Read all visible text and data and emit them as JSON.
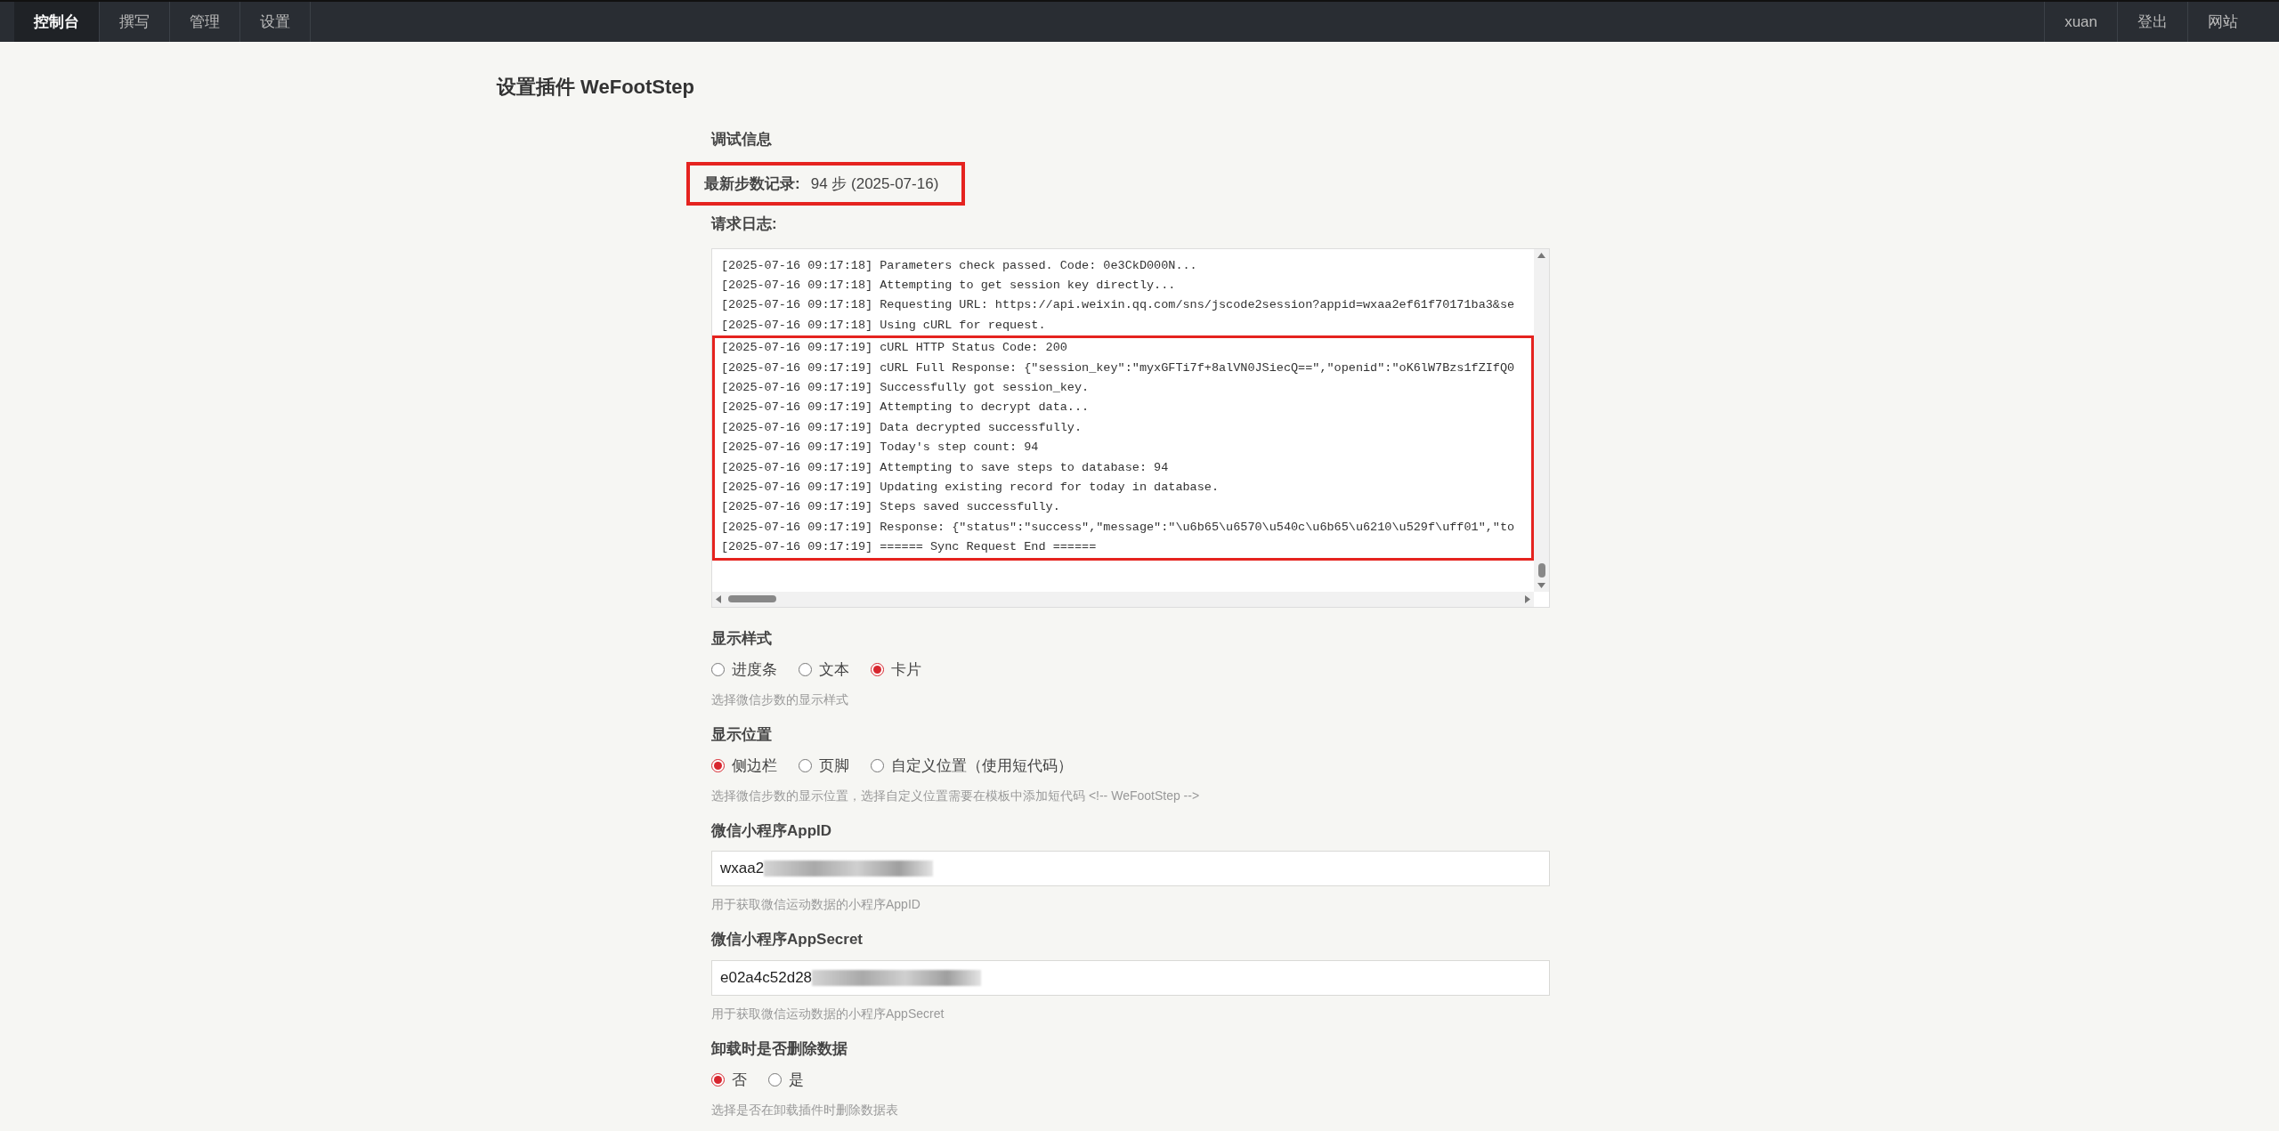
{
  "nav": {
    "items": [
      {
        "label": "控制台",
        "selected": true
      },
      {
        "label": "撰写",
        "selected": false
      },
      {
        "label": "管理",
        "selected": false
      },
      {
        "label": "设置",
        "selected": false
      }
    ],
    "right_items": [
      "xuan",
      "登出",
      "网站"
    ]
  },
  "page_title": "设置插件 WeFootStep",
  "debug": {
    "heading": "调试信息",
    "latest_label": "最新步数记录:",
    "latest_value": "94 步 (2025-07-16)",
    "latest_highlighted": true,
    "log_label": "请求日志:",
    "log_blocks": [
      {
        "highlighted": false,
        "lines": [
          "[2025-07-16 09:17:18] Parameters check passed. Code: 0e3CkD000N...",
          "[2025-07-16 09:17:18] Attempting to get session key directly...",
          "[2025-07-16 09:17:18] Requesting URL: https://api.weixin.qq.com/sns/jscode2session?appid=wxaa2ef61f70171ba3&se",
          "[2025-07-16 09:17:18] Using cURL for request."
        ]
      },
      {
        "highlighted": true,
        "lines": [
          "[2025-07-16 09:17:19] cURL HTTP Status Code: 200",
          "[2025-07-16 09:17:19] cURL Full Response: {\"session_key\":\"myxGFTi7f+8alVN0JSiecQ==\",\"openid\":\"oK6lW7Bzs1fZIfQ0",
          "[2025-07-16 09:17:19] Successfully got session_key.",
          "[2025-07-16 09:17:19] Attempting to decrypt data...",
          "[2025-07-16 09:17:19] Data decrypted successfully.",
          "[2025-07-16 09:17:19] Today's step count: 94",
          "[2025-07-16 09:17:19] Attempting to save steps to database: 94",
          "[2025-07-16 09:17:19] Updating existing record for today in database.",
          "[2025-07-16 09:17:19] Steps saved successfully.",
          "[2025-07-16 09:17:19] Response: {\"status\":\"success\",\"message\":\"\\u6b65\\u6570\\u540c\\u6b65\\u6210\\u529f\\uff01\",\"to",
          "[2025-07-16 09:17:19] ====== Sync Request End ======"
        ]
      }
    ]
  },
  "settings": [
    {
      "kind": "radio",
      "label": "显示样式",
      "options": [
        {
          "label": "进度条",
          "selected": false
        },
        {
          "label": "文本",
          "selected": false
        },
        {
          "label": "卡片",
          "selected": true
        }
      ],
      "hint": "选择微信步数的显示样式"
    },
    {
      "kind": "radio",
      "label": "显示位置",
      "options": [
        {
          "label": "侧边栏",
          "selected": true
        },
        {
          "label": "页脚",
          "selected": false
        },
        {
          "label": "自定义位置（使用短代码）",
          "selected": false
        }
      ],
      "hint": "选择微信步数的显示位置，选择自定义位置需要在模板中添加短代码 <!-- WeFootStep -->"
    },
    {
      "kind": "text",
      "label": "微信小程序AppID",
      "value": "wxaa2",
      "redacted": true,
      "hint": "用于获取微信运动数据的小程序AppID"
    },
    {
      "kind": "text",
      "label": "微信小程序AppSecret",
      "value": "e02a4c52d28",
      "redacted": true,
      "hint": "用于获取微信运动数据的小程序AppSecret"
    },
    {
      "kind": "radio",
      "label": "卸载时是否删除数据",
      "options": [
        {
          "label": "否",
          "selected": true
        },
        {
          "label": "是",
          "selected": false
        }
      ],
      "hint": "选择是否在卸载插件时删除数据表"
    }
  ]
}
